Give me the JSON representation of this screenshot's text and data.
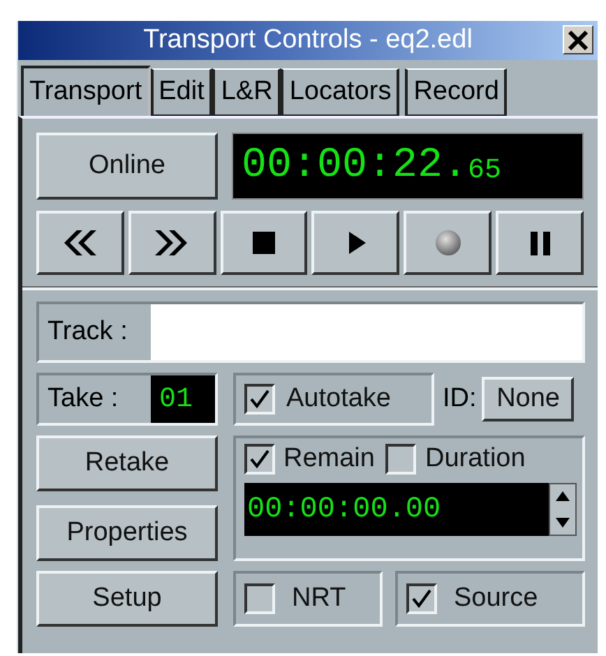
{
  "window": {
    "title": "Transport Controls - eq2.edl"
  },
  "tabs": [
    {
      "label": "Transport",
      "selected": true
    },
    {
      "label": "Edit",
      "selected": false
    },
    {
      "label": "L&R",
      "selected": false
    },
    {
      "label": "Locators",
      "selected": false
    },
    {
      "label": "Record",
      "selected": false
    }
  ],
  "online_button": "Online",
  "timecode": {
    "main": "00:00:22.",
    "fraction": "65"
  },
  "transport_buttons": [
    {
      "kind": "rewind"
    },
    {
      "kind": "fast_forward"
    },
    {
      "kind": "stop"
    },
    {
      "kind": "play"
    },
    {
      "kind": "record"
    },
    {
      "kind": "pause"
    }
  ],
  "track": {
    "label": "Track :"
  },
  "take": {
    "label": "Take :",
    "value": "01"
  },
  "autotake": {
    "label": "Autotake",
    "checked": true
  },
  "id": {
    "label": "ID:",
    "button": "None"
  },
  "buttons": [
    "Retake",
    "Properties",
    "Setup"
  ],
  "remain": {
    "label": "Remain",
    "checked": true
  },
  "duration": {
    "label": "Duration",
    "checked": false
  },
  "counter": "00:00:00.00",
  "nrt": {
    "label": "NRT",
    "checked": false
  },
  "source": {
    "label": "Source",
    "checked": true
  }
}
